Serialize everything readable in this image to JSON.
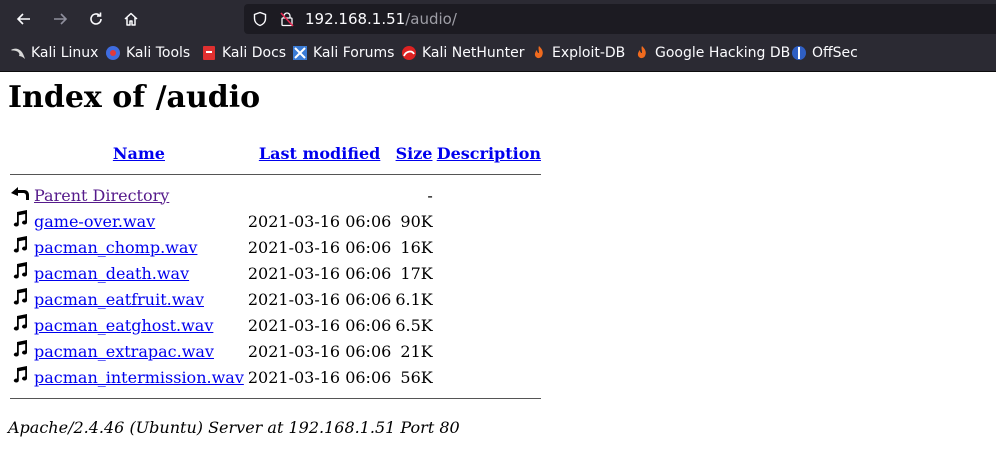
{
  "browser": {
    "url_host": "192.168.1.51",
    "url_path": "/audio/",
    "bookmarks": [
      {
        "label": "Kali Linux",
        "icon": "kali-dragon-icon"
      },
      {
        "label": "Kali Tools",
        "icon": "kali-tools-icon"
      },
      {
        "label": "Kali Docs",
        "icon": "kali-docs-icon"
      },
      {
        "label": "Kali Forums",
        "icon": "kali-forums-icon"
      },
      {
        "label": "Kali NetHunter",
        "icon": "kali-nethunter-icon"
      },
      {
        "label": "Exploit-DB",
        "icon": "exploit-db-icon"
      },
      {
        "label": "Google Hacking DB",
        "icon": "ghdb-icon"
      },
      {
        "label": "OffSec",
        "icon": "offsec-icon"
      }
    ]
  },
  "page": {
    "title": "Index of /audio",
    "headers": {
      "name": "Name",
      "modified": "Last modified",
      "size": "Size",
      "description": "Description"
    },
    "parent": {
      "name": "Parent Directory",
      "size": "-"
    },
    "files": [
      {
        "name": "game-over.wav",
        "modified": "2021-03-16 06:06",
        "size": "90K"
      },
      {
        "name": "pacman_chomp.wav",
        "modified": "2021-03-16 06:06",
        "size": "16K"
      },
      {
        "name": "pacman_death.wav",
        "modified": "2021-03-16 06:06",
        "size": "17K"
      },
      {
        "name": "pacman_eatfruit.wav",
        "modified": "2021-03-16 06:06",
        "size": "6.1K"
      },
      {
        "name": "pacman_eatghost.wav",
        "modified": "2021-03-16 06:06",
        "size": "6.5K"
      },
      {
        "name": "pacman_extrapac.wav",
        "modified": "2021-03-16 06:06",
        "size": "21K"
      },
      {
        "name": "pacman_intermission.wav",
        "modified": "2021-03-16 06:06",
        "size": "56K"
      }
    ],
    "footer": "Apache/2.4.46 (Ubuntu) Server at 192.168.1.51 Port 80"
  }
}
